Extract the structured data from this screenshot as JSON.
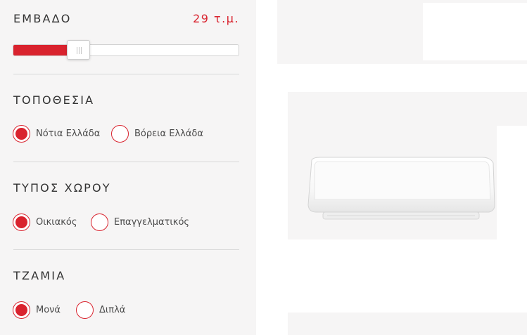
{
  "area": {
    "title": "ΕΜΒΑΔΟ",
    "value_text": "29 τ.μ.",
    "slider_fraction": 0.29
  },
  "location": {
    "title": "ΤΟΠΟΘΕΣΙΑ",
    "options": [
      {
        "label": "Νότια Ελλάδα",
        "selected": true
      },
      {
        "label": "Βόρεια Ελλάδα",
        "selected": false
      }
    ]
  },
  "space_type": {
    "title": "ΤΥΠΟΣ ΧΩΡΟΥ",
    "options": [
      {
        "label": "Οικιακός",
        "selected": true
      },
      {
        "label": "Επαγγελματικός",
        "selected": false
      }
    ]
  },
  "glazing": {
    "title": "ΤΖΑΜΙΑ",
    "options": [
      {
        "label": "Μονά",
        "selected": true
      },
      {
        "label": "Διπλά",
        "selected": false
      }
    ]
  },
  "colors": {
    "accent": "#d9232e",
    "panel_bg": "#f6f5f5"
  },
  "product": {
    "icon": "air-conditioner-image"
  }
}
